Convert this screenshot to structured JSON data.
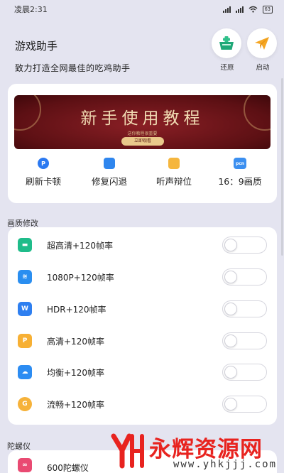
{
  "status_bar": {
    "time": "凌晨2:31",
    "battery": "63"
  },
  "header": {
    "title": "游戏助手",
    "subtitle": "致力打造全网最佳的吃鸡助手"
  },
  "top_buttons": [
    {
      "label": "还原",
      "icon": "basket-icon"
    },
    {
      "label": "启动",
      "icon": "paper-plane-icon"
    }
  ],
  "banner": {
    "title": "新手使用教程",
    "subtitle": "送你教程很重要",
    "button": "立即观看"
  },
  "quick_actions": [
    {
      "label": "刷新卡顿",
      "icon": "refresh-icon",
      "color": "#2b79f1",
      "glyph": "P"
    },
    {
      "label": "修复闪退",
      "icon": "repair-icon",
      "color": "#2f86ee",
      "glyph": ""
    },
    {
      "label": "听声辩位",
      "icon": "sound-icon",
      "color": "#f5b63e",
      "glyph": ""
    },
    {
      "label": "16：9画质",
      "icon": "ratio-icon",
      "color": "#3b8ff0",
      "glyph": "pcn"
    }
  ],
  "quality_section": {
    "title": "画质修改",
    "rows": [
      {
        "label": "超高清+120帧率",
        "icon": "ultra-hd-icon",
        "color": "#1fbc8a",
        "glyph": "▬",
        "enabled": false
      },
      {
        "label": "1080P+120帧率",
        "icon": "layers-icon",
        "color": "#2a8ef0",
        "glyph": "≋",
        "enabled": false
      },
      {
        "label": "HDR+120帧率",
        "icon": "hdr-icon",
        "color": "#2e7ff0",
        "glyph": "W",
        "enabled": false
      },
      {
        "label": "高清+120帧率",
        "icon": "hd-icon",
        "color": "#f7b034",
        "glyph": "P",
        "enabled": false
      },
      {
        "label": "均衡+120帧率",
        "icon": "cloud-icon",
        "color": "#2c8cf2",
        "glyph": "☁",
        "enabled": false
      },
      {
        "label": "流畅+120帧率",
        "icon": "smooth-icon",
        "color": "#f6b23a",
        "glyph": "G",
        "enabled": false
      }
    ]
  },
  "gyro_section": {
    "title": "陀螺仪",
    "rows": [
      {
        "label": "600陀螺仪",
        "icon": "gyro-icon",
        "color": "#e94a72",
        "glyph": "∞",
        "enabled": false
      }
    ]
  },
  "watermark": {
    "text": "永辉资源网",
    "url": "www.yhkjjj.com"
  }
}
